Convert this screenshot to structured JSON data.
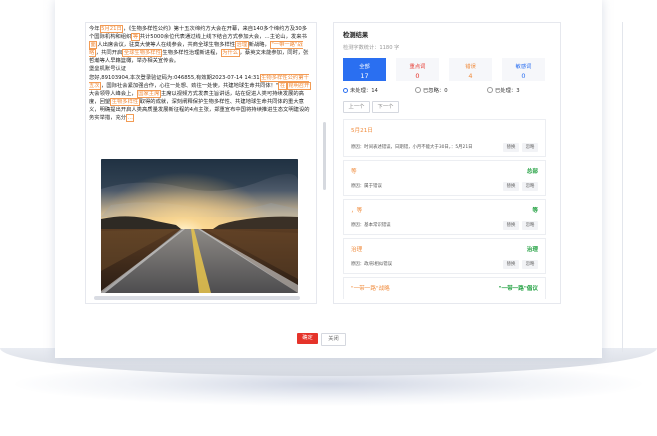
{
  "editor": {
    "paragraph1": [
      {
        "t": "今年"
      },
      {
        "t": "5月21日",
        "hl": true
      },
      {
        "t": "，《生物多样性公约》第十五次缔约方大会在开幕，来自140多个缔约方及30多个国际机构和组织"
      },
      {
        "t": "等",
        "hl": true
      },
      {
        "t": "共计5000余位代表通过线上线下结合方式参加大会，…主论山，发来书"
      },
      {
        "t": "面",
        "hl": true
      },
      {
        "t": "人出席会议，驻莫大使等人在线参会，共商全球生物多样性"
      },
      {
        "t": "治理",
        "hl": true
      },
      {
        "t": "新战略，"
      },
      {
        "t": "\"一带一路\"战略",
        "hl": true
      },
      {
        "t": "，共同开启"
      },
      {
        "t": "全球生物多样性",
        "hl": true
      },
      {
        "t": "生物多样性治理新进程，"
      },
      {
        "t": "为什么",
        "hl": true
      },
      {
        "t": "，蔡英文未能参加，同时，张哲瀚等人早籍篮橄，举办相关宣传会。"
      }
    ],
    "certification": "堡垒机账号认证",
    "paragraph3": [
      {
        "t": "    您好,89103904,本次登录验证码为:046855,有效期2023-07-14 14:31"
      },
      {
        "t": "生物多样性公约第十五次",
        "hl": true
      },
      {
        "t": "，国际社会紧加强合作，心往一处想、劲往一处使，共建地球生命共同体！\""
      },
      {
        "t": "在",
        "hl": true
      },
      {
        "t": "昆明召开",
        "hl": true
      },
      {
        "t": "大会领导人峰会上，"
      },
      {
        "t": "国家主席",
        "hl": true
      },
      {
        "t": "主席以视频方式发表主旨讲话，站在促进人类可持续发展的高度，回望"
      },
      {
        "t": "生物多样性",
        "hl": true
      },
      {
        "t": "取得的成就，深刻阐释保护生物多样性、共建地球生命共同体的重大意义，明确提出开启人类高质量发展新征程的4点主张，郑重宣布中国将持续推进生态文明建设的务实举措，充分"
      },
      {
        "t": "…",
        "hl": true
      }
    ]
  },
  "panel": {
    "title": "检测结果",
    "word_count": "检测字数统计：1180 字",
    "tabs": [
      {
        "label": "全部",
        "count": "17",
        "color": "#ffffff",
        "active": true
      },
      {
        "label": "重点词",
        "count": "0",
        "color": "#e5332a",
        "active": false
      },
      {
        "label": "错误",
        "count": "4",
        "color": "#f08a3a",
        "active": false
      },
      {
        "label": "敏感词",
        "count": "0",
        "color": "#2a6ff1",
        "active": false
      }
    ],
    "filters": [
      {
        "label": "未处理：14",
        "checked": true
      },
      {
        "label": "已忽略：0",
        "checked": false
      },
      {
        "label": "已处理：3",
        "checked": false
      }
    ],
    "prev_label": "上一个",
    "next_label": "下一个",
    "results": [
      {
        "title": "5月21日",
        "keyword": "",
        "desc": "原因：时间表述错误，日期错，小月不能大于30日，：5月21日",
        "show_buttons": true
      },
      {
        "title": "等",
        "keyword": "总部",
        "desc": "原因：属于错误",
        "show_buttons": true
      },
      {
        "title": "，等",
        "keyword": "等",
        "desc": "原因：基本常识错误",
        "show_buttons": true
      },
      {
        "title": "治理",
        "keyword": "治理",
        "desc": "原因：政/形相似错误",
        "show_buttons": true
      },
      {
        "title": "\"一带一路\"战略",
        "keyword": "\"一带一路\"倡议",
        "desc": "",
        "show_buttons": false
      }
    ],
    "replace_label": "替换",
    "ignore_label": "忽略"
  },
  "footer": {
    "ok_label": "确定",
    "close_label": "关闭"
  },
  "colors": {
    "accent": "#2a6ff1",
    "error": "#f08a3a",
    "danger": "#e5332a",
    "success": "#25a244"
  }
}
